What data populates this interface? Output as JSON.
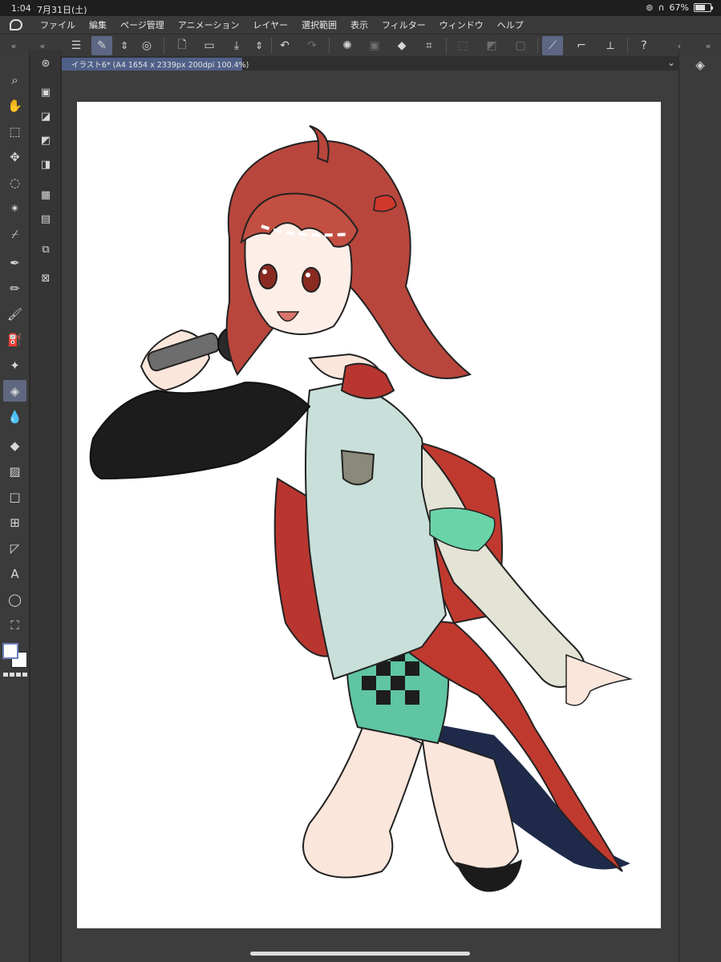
{
  "status": {
    "time": "1:04",
    "date": "7月31日(土)",
    "battery": "67%",
    "battery_level": 0.67
  },
  "menu": {
    "items": [
      "ファイル",
      "編集",
      "ページ管理",
      "アニメーション",
      "レイヤー",
      "選択範囲",
      "表示",
      "フィルター",
      "ウィンドウ",
      "ヘルプ"
    ]
  },
  "toolbar": {
    "icons": [
      "menu-icon",
      "quick-access-icon",
      "updown-icon",
      "eraser-mode-icon",
      "new-file-icon",
      "open-file-icon",
      "save-icon",
      "updown-icon",
      "undo-icon",
      "redo-icon",
      "loading-icon",
      "transform-icon",
      "fill-icon",
      "crop-icon",
      "deselect-icon",
      "invert-selection-icon",
      "selection-border-icon",
      "snap-ruler-icon",
      "snap-brush-icon",
      "snap-pen-icon",
      "help-icon"
    ]
  },
  "tools": [
    "zoom-icon",
    "hand-icon",
    "select-layer-icon",
    "move-icon",
    "lasso-icon",
    "magic-wand-icon",
    "eyedropper-icon",
    "pen-icon",
    "pencil-icon",
    "brush-icon",
    "airbrush-icon",
    "decoration-icon",
    "eraser-icon",
    "blend-icon",
    "fill-icon",
    "gradient-icon",
    "figure-icon",
    "frame-icon",
    "ruler-icon",
    "text-icon",
    "balloon-icon",
    "correct-line-icon"
  ],
  "document": {
    "tab_label": "イラスト6* (A4 1654 x 2339px 200dpi 100.4%)"
  },
  "colors": {
    "accent": "#5f6781",
    "tab": "#4f6088",
    "panel": "#3b3b3b",
    "canvas_bg": "#3d3d3d"
  }
}
